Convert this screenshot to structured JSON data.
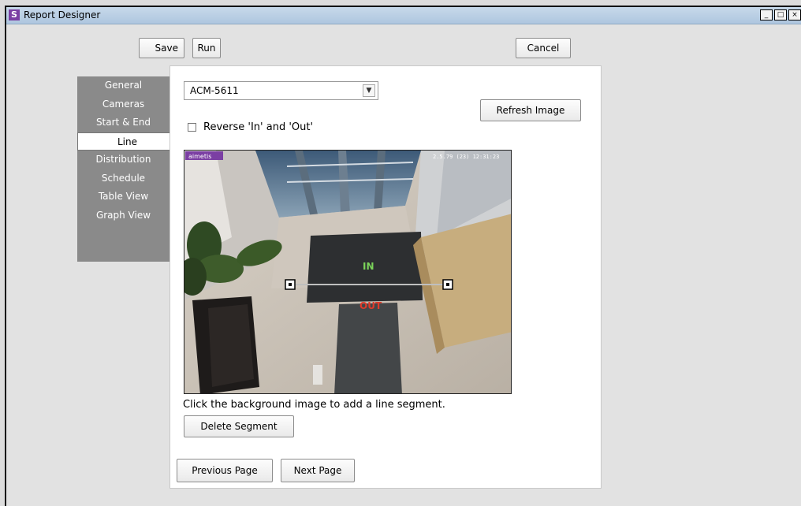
{
  "window": {
    "title": "Report Designer",
    "icon": "report-app-icon"
  },
  "toolbar": {
    "save_label": "Save",
    "run_label": "Run",
    "cancel_label": "Cancel"
  },
  "nav": {
    "items": [
      {
        "label": "General"
      },
      {
        "label": "Cameras"
      },
      {
        "label": "Start & End"
      },
      {
        "label": "Line",
        "active": true
      },
      {
        "label": "Distribution"
      },
      {
        "label": "Schedule"
      },
      {
        "label": "Table View"
      },
      {
        "label": "Graph View"
      }
    ]
  },
  "camera_select": {
    "value": "ACM-5611"
  },
  "refresh_label": "Refresh Image",
  "reverse": {
    "label": "Reverse 'In' and 'Out'",
    "checked": false
  },
  "image": {
    "logo": "aimetis",
    "timestamp": "2.5.79 (23) 12:31:23",
    "in_label": "IN",
    "out_label": "OUT"
  },
  "hint": "Click the background image to add a line segment.",
  "buttons": {
    "delete_segment": "Delete Segment",
    "previous_page": "Previous Page",
    "next_page": "Next Page"
  },
  "colors": {
    "nav_bg": "#8a8a8a",
    "in": "#7bd35a",
    "out": "#e03a2a",
    "brand": "#7b3fa3"
  }
}
